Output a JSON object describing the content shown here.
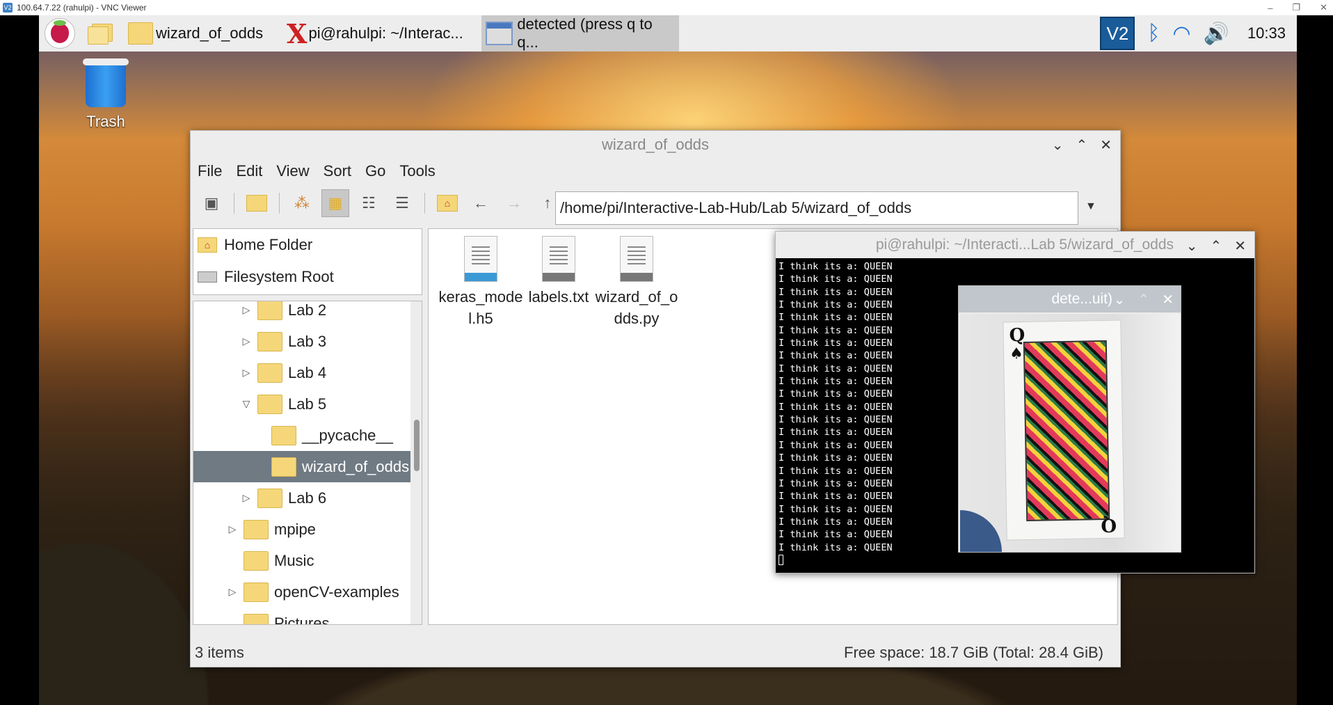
{
  "vnc": {
    "title": "100.64.7.22 (rahulpi) - VNC Viewer",
    "logo": "V2",
    "controls": [
      "–",
      "❐",
      "✕"
    ]
  },
  "taskbar": {
    "tasks": [
      {
        "label": "wizard_of_odds",
        "icon": "folder-icon"
      },
      {
        "label": "pi@rahulpi: ~/Interac...",
        "icon": "terminal-icon"
      },
      {
        "label": "detected (press q to q...",
        "icon": "window-icon",
        "active": true
      }
    ],
    "tray": {
      "vnc": "V2",
      "clock": "10:33"
    }
  },
  "desktop": {
    "trash_label": "Trash"
  },
  "file_manager": {
    "title": "wizard_of_odds",
    "menu": [
      "File",
      "Edit",
      "View",
      "Sort",
      "Go",
      "Tools"
    ],
    "path": "/home/pi/Interactive-Lab-Hub/Lab 5/wizard_of_odds",
    "places": [
      "Home Folder",
      "Filesystem Root"
    ],
    "tree": [
      {
        "label": "Lab 2",
        "expander": "▷",
        "indent": 1
      },
      {
        "label": "Lab 3",
        "expander": "▷",
        "indent": 1
      },
      {
        "label": "Lab 4",
        "expander": "▷",
        "indent": 1
      },
      {
        "label": "Lab 5",
        "expander": "▽",
        "indent": 1
      },
      {
        "label": "__pycache__",
        "expander": "",
        "indent": 2
      },
      {
        "label": "wizard_of_odds",
        "expander": "",
        "indent": 2,
        "selected": true
      },
      {
        "label": "Lab 6",
        "expander": "▷",
        "indent": 1
      },
      {
        "label": "mpipe",
        "expander": "▷",
        "indent": 0
      },
      {
        "label": "Music",
        "expander": "",
        "indent": 0
      },
      {
        "label": "openCV-examples",
        "expander": "▷",
        "indent": 0
      },
      {
        "label": "Pictures",
        "expander": "",
        "indent": 0
      }
    ],
    "files": [
      {
        "line1": "keras_mode",
        "line2": "l.h5",
        "type": "h5"
      },
      {
        "line1": "labels.txt",
        "line2": "",
        "type": "txt"
      },
      {
        "line1": "wizard_of_o",
        "line2": "dds.py",
        "type": "py"
      }
    ],
    "status_left": "3 items",
    "status_right": "Free space: 18.7 GiB (Total: 28.4 GiB)"
  },
  "terminal": {
    "title": "pi@rahulpi: ~/Interacti...Lab 5/wizard_of_odds",
    "lines": [
      "I think its a: QUEEN",
      "I think its a: QUEEN",
      "I think its a: QUEEN",
      "I think its a: QUEEN",
      "I think its a: QUEEN",
      "I think its a: QUEEN",
      "I think its a: QUEEN",
      "I think its a: QUEEN",
      "I think its a: QUEEN",
      "I think its a: QUEEN",
      "I think its a: QUEEN",
      "I think its a: QUEEN",
      "I think its a: QUEEN",
      "I think its a: QUEEN",
      "I think its a: QUEEN",
      "I think its a: QUEEN",
      "I think its a: QUEEN",
      "I think its a: QUEEN",
      "I think its a: QUEEN",
      "I think its a: QUEEN",
      "I think its a: QUEEN",
      "I think its a: QUEEN",
      "I think its a: QUEEN"
    ]
  },
  "camera": {
    "title": "dete...uit)",
    "card_rank": "Q",
    "card_suit": "♠",
    "card_corner": "Q"
  },
  "icons": {
    "minimize": "⌄",
    "maximize": "⌃",
    "close": "✕"
  }
}
